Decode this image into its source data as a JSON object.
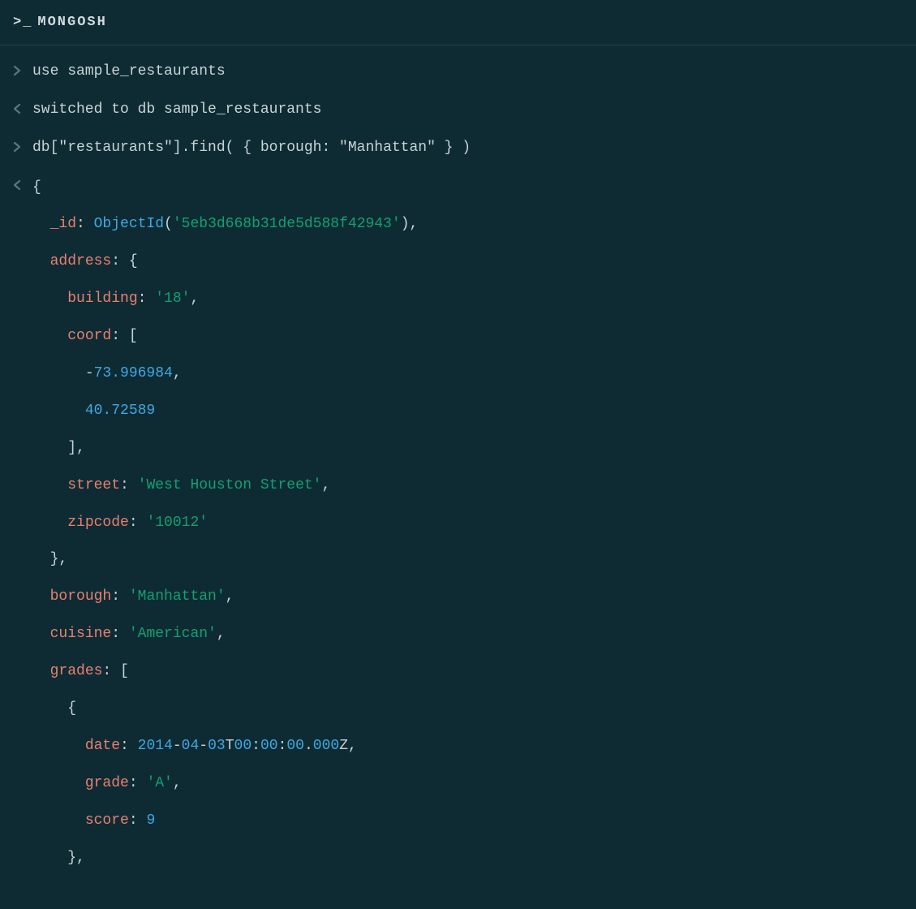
{
  "header": {
    "prompt": ">_",
    "title": "MONGOSH"
  },
  "lines": {
    "cmd1": "use sample_restaurants",
    "resp1": "switched to db sample_restaurants",
    "cmd2": "db[\"restaurants\"].find( { borough: \"Manhattan\" } )"
  },
  "doc": {
    "open": "{",
    "id_key": "_id",
    "id_fn": "ObjectId",
    "id_open": "(",
    "id_val": "'5eb3d668b31de5d588f42943'",
    "id_close": "),",
    "address_key": "address",
    "address_open": ": {",
    "building_key": "building",
    "building_val": "'18'",
    "coord_key": "coord",
    "coord_open": ": [",
    "coord0_neg": "-",
    "coord0": "73.996984",
    "coord1": "40.72589",
    "coord_close": "],",
    "street_key": "street",
    "street_val": "'West Houston Street'",
    "zipcode_key": "zipcode",
    "zipcode_val": "'10012'",
    "address_close": "},",
    "borough_key": "borough",
    "borough_val": "'Manhattan'",
    "cuisine_key": "cuisine",
    "cuisine_val": "'American'",
    "grades_key": "grades",
    "grades_open": ": [",
    "grade_open": "{",
    "date_key": "date",
    "date_y": "2014",
    "date_m": "04",
    "date_d": "03",
    "date_t": "T",
    "date_h": "00",
    "date_mi": "00",
    "date_s": "00",
    "date_ms": "000",
    "date_z": "Z,",
    "grade_key": "grade",
    "grade_val": "'A'",
    "score_key": "score",
    "score_val": "9",
    "grade_close": "},"
  },
  "colon_sp": ": ",
  "colon": ":",
  "comma": ",",
  "dash": "-",
  "dot": "."
}
